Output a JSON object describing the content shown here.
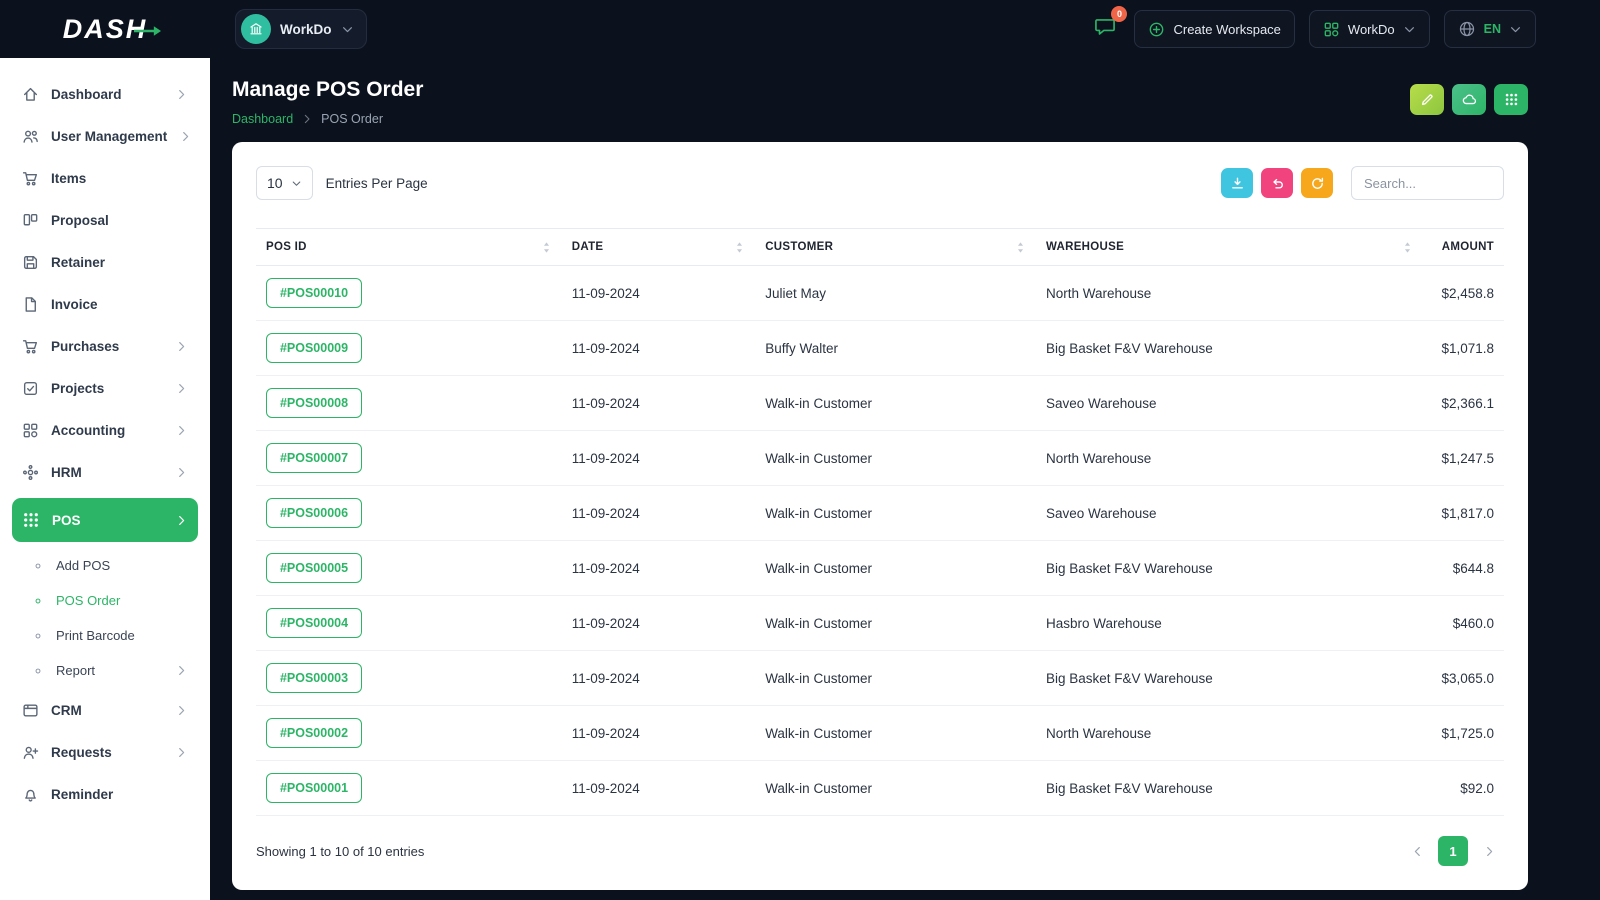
{
  "brand": {
    "logo_text": "DASH"
  },
  "topbar": {
    "workspace_chip": {
      "label": "WorkDo"
    },
    "messages_badge": "0",
    "create_workspace_label": "Create Workspace",
    "workspace_dropdown_label": "WorkDo",
    "language_label": "EN"
  },
  "sidebar": {
    "items": [
      {
        "label": "Dashboard",
        "icon": "home",
        "chevron": true
      },
      {
        "label": "User Management",
        "icon": "users",
        "chevron": true
      },
      {
        "label": "Items",
        "icon": "cart"
      },
      {
        "label": "Proposal",
        "icon": "kanban"
      },
      {
        "label": "Retainer",
        "icon": "save"
      },
      {
        "label": "Invoice",
        "icon": "file"
      },
      {
        "label": "Purchases",
        "icon": "cart",
        "chevron": true
      },
      {
        "label": "Projects",
        "icon": "check-square",
        "chevron": true
      },
      {
        "label": "Accounting",
        "icon": "blocks",
        "chevron": true
      },
      {
        "label": "HRM",
        "icon": "hrm",
        "chevron": true
      },
      {
        "label": "POS",
        "icon": "apps",
        "chevron": true,
        "active": true,
        "expanded": true
      },
      {
        "label": "Add POS",
        "icon": "dot",
        "sub": true
      },
      {
        "label": "POS Order",
        "icon": "dot",
        "sub": true,
        "current": true
      },
      {
        "label": "Print Barcode",
        "icon": "dot",
        "sub": true
      },
      {
        "label": "Report",
        "icon": "dot",
        "sub": true,
        "chevron": true
      },
      {
        "label": "CRM",
        "icon": "crm",
        "chevron": true
      },
      {
        "label": "Requests",
        "icon": "user-plus",
        "chevron": true
      },
      {
        "label": "Reminder",
        "icon": "bell"
      }
    ]
  },
  "page": {
    "title": "Manage POS Order",
    "breadcrumbs": [
      {
        "label": "Dashboard"
      },
      {
        "label": "POS Order"
      }
    ]
  },
  "toolbar": {
    "entries_value": "10",
    "entries_label": "Entries Per Page",
    "search_placeholder": "Search..."
  },
  "table": {
    "columns": [
      {
        "label": "POS ID",
        "sortable": true
      },
      {
        "label": "DATE",
        "sortable": true
      },
      {
        "label": "CUSTOMER",
        "sortable": true
      },
      {
        "label": "WAREHOUSE",
        "sortable": true
      },
      {
        "label": "AMOUNT",
        "sortable": false
      }
    ],
    "rows": [
      {
        "pos_id": "#POS00010",
        "date": "11-09-2024",
        "customer": "Juliet May",
        "warehouse": "North Warehouse",
        "amount": "$2,458.8"
      },
      {
        "pos_id": "#POS00009",
        "date": "11-09-2024",
        "customer": "Buffy Walter",
        "warehouse": "Big Basket F&V Warehouse",
        "amount": "$1,071.8"
      },
      {
        "pos_id": "#POS00008",
        "date": "11-09-2024",
        "customer": "Walk-in Customer",
        "warehouse": "Saveo Warehouse",
        "amount": "$2,366.1"
      },
      {
        "pos_id": "#POS00007",
        "date": "11-09-2024",
        "customer": "Walk-in Customer",
        "warehouse": "North Warehouse",
        "amount": "$1,247.5"
      },
      {
        "pos_id": "#POS00006",
        "date": "11-09-2024",
        "customer": "Walk-in Customer",
        "warehouse": "Saveo Warehouse",
        "amount": "$1,817.0"
      },
      {
        "pos_id": "#POS00005",
        "date": "11-09-2024",
        "customer": "Walk-in Customer",
        "warehouse": "Big Basket F&V Warehouse",
        "amount": "$644.8"
      },
      {
        "pos_id": "#POS00004",
        "date": "11-09-2024",
        "customer": "Walk-in Customer",
        "warehouse": "Hasbro Warehouse",
        "amount": "$460.0"
      },
      {
        "pos_id": "#POS00003",
        "date": "11-09-2024",
        "customer": "Walk-in Customer",
        "warehouse": "Big Basket F&V Warehouse",
        "amount": "$3,065.0"
      },
      {
        "pos_id": "#POS00002",
        "date": "11-09-2024",
        "customer": "Walk-in Customer",
        "warehouse": "North Warehouse",
        "amount": "$1,725.0"
      },
      {
        "pos_id": "#POS00001",
        "date": "11-09-2024",
        "customer": "Walk-in Customer",
        "warehouse": "Big Basket F&V Warehouse",
        "amount": "$92.0"
      }
    ],
    "footer_text": "Showing 1 to 10 of 10 entries",
    "pagination": {
      "current_page": "1"
    }
  },
  "colors": {
    "primary_green": "#2db567",
    "dark_background": "#0b111d",
    "teal_button": "#3fc5e0",
    "pink_button": "#f1437e",
    "orange_button": "#f6a71b",
    "lime_button": "#a6d44a",
    "badge_red": "#f06548",
    "avatar_teal": "#2fbfa0"
  }
}
